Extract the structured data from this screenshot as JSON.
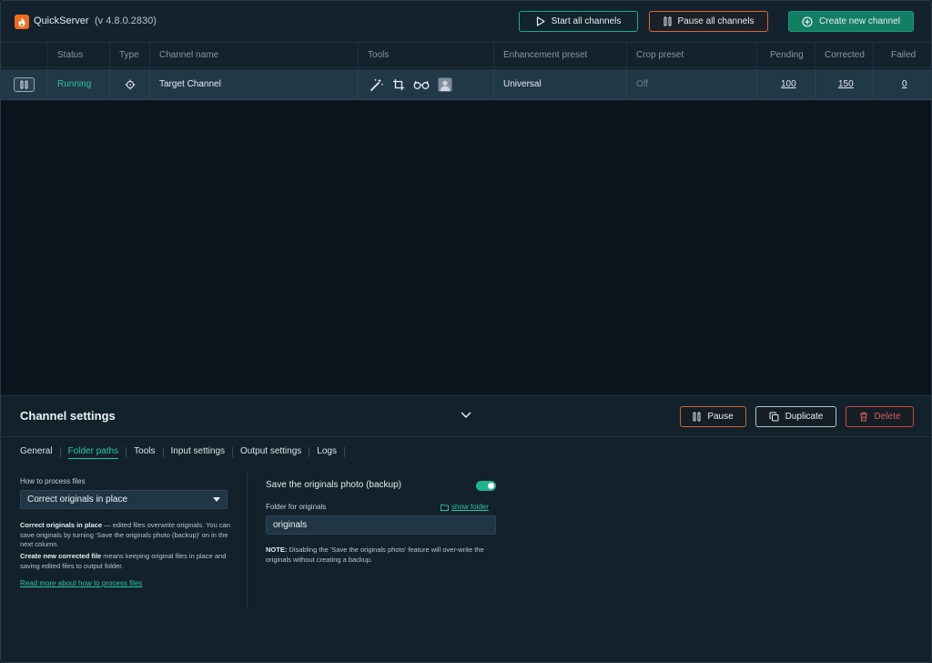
{
  "header": {
    "app_name": "QuickServer",
    "version": "(v 4.8.0.2830)",
    "start_all": "Start all channels",
    "pause_all": "Pause all channels",
    "create_new": "Create new channel"
  },
  "table": {
    "columns": {
      "status": "Status",
      "type": "Type",
      "channel_name": "Channel name",
      "tools": "Tools",
      "enhancement_preset": "Enhancement preset",
      "crop_preset": "Crop preset",
      "pending": "Pending",
      "corrected": "Corrected",
      "failed": "Failed"
    },
    "rows": [
      {
        "status": "Running",
        "channel_name": "Target Channel",
        "enhancement_preset": "Universal",
        "crop_preset": "Off",
        "pending": "100",
        "corrected": "150",
        "failed": "0"
      }
    ]
  },
  "settings": {
    "title": "Channel settings",
    "pause": "Pause",
    "duplicate": "Duplicate",
    "delete": "Delete",
    "tabs": [
      "General",
      "Folder paths",
      "Tools",
      "Input settings",
      "Output settings",
      "Logs"
    ],
    "active_tab": "Folder paths",
    "process_label": "How to process files",
    "process_value": "Correct originals in place",
    "desc1_bold": "Correct originals in place",
    "desc1_rest": " — edited files overwrite originals. You can save originals by turning 'Save the originals photo (backup)' on in the next column.",
    "desc2_bold": "Create new corrected file",
    "desc2_rest": " means keeping original files in place and saving edited files to output folder.",
    "read_more": "Read more about how to process files",
    "backup_label": "Save the originals photo (backup)",
    "backup_enabled": true,
    "folder_label": "Folder for originals",
    "show_folder": "show folder",
    "folder_value": "originals",
    "note_bold": "NOTE:",
    "note_rest": " Disabling the 'Save the originals photo' feature will over-write the originals without creating a backup."
  },
  "colors": {
    "accent": "#2ac69f",
    "running": "#28c59d",
    "logo": "#f26b1d",
    "danger": "#e05a5a"
  }
}
